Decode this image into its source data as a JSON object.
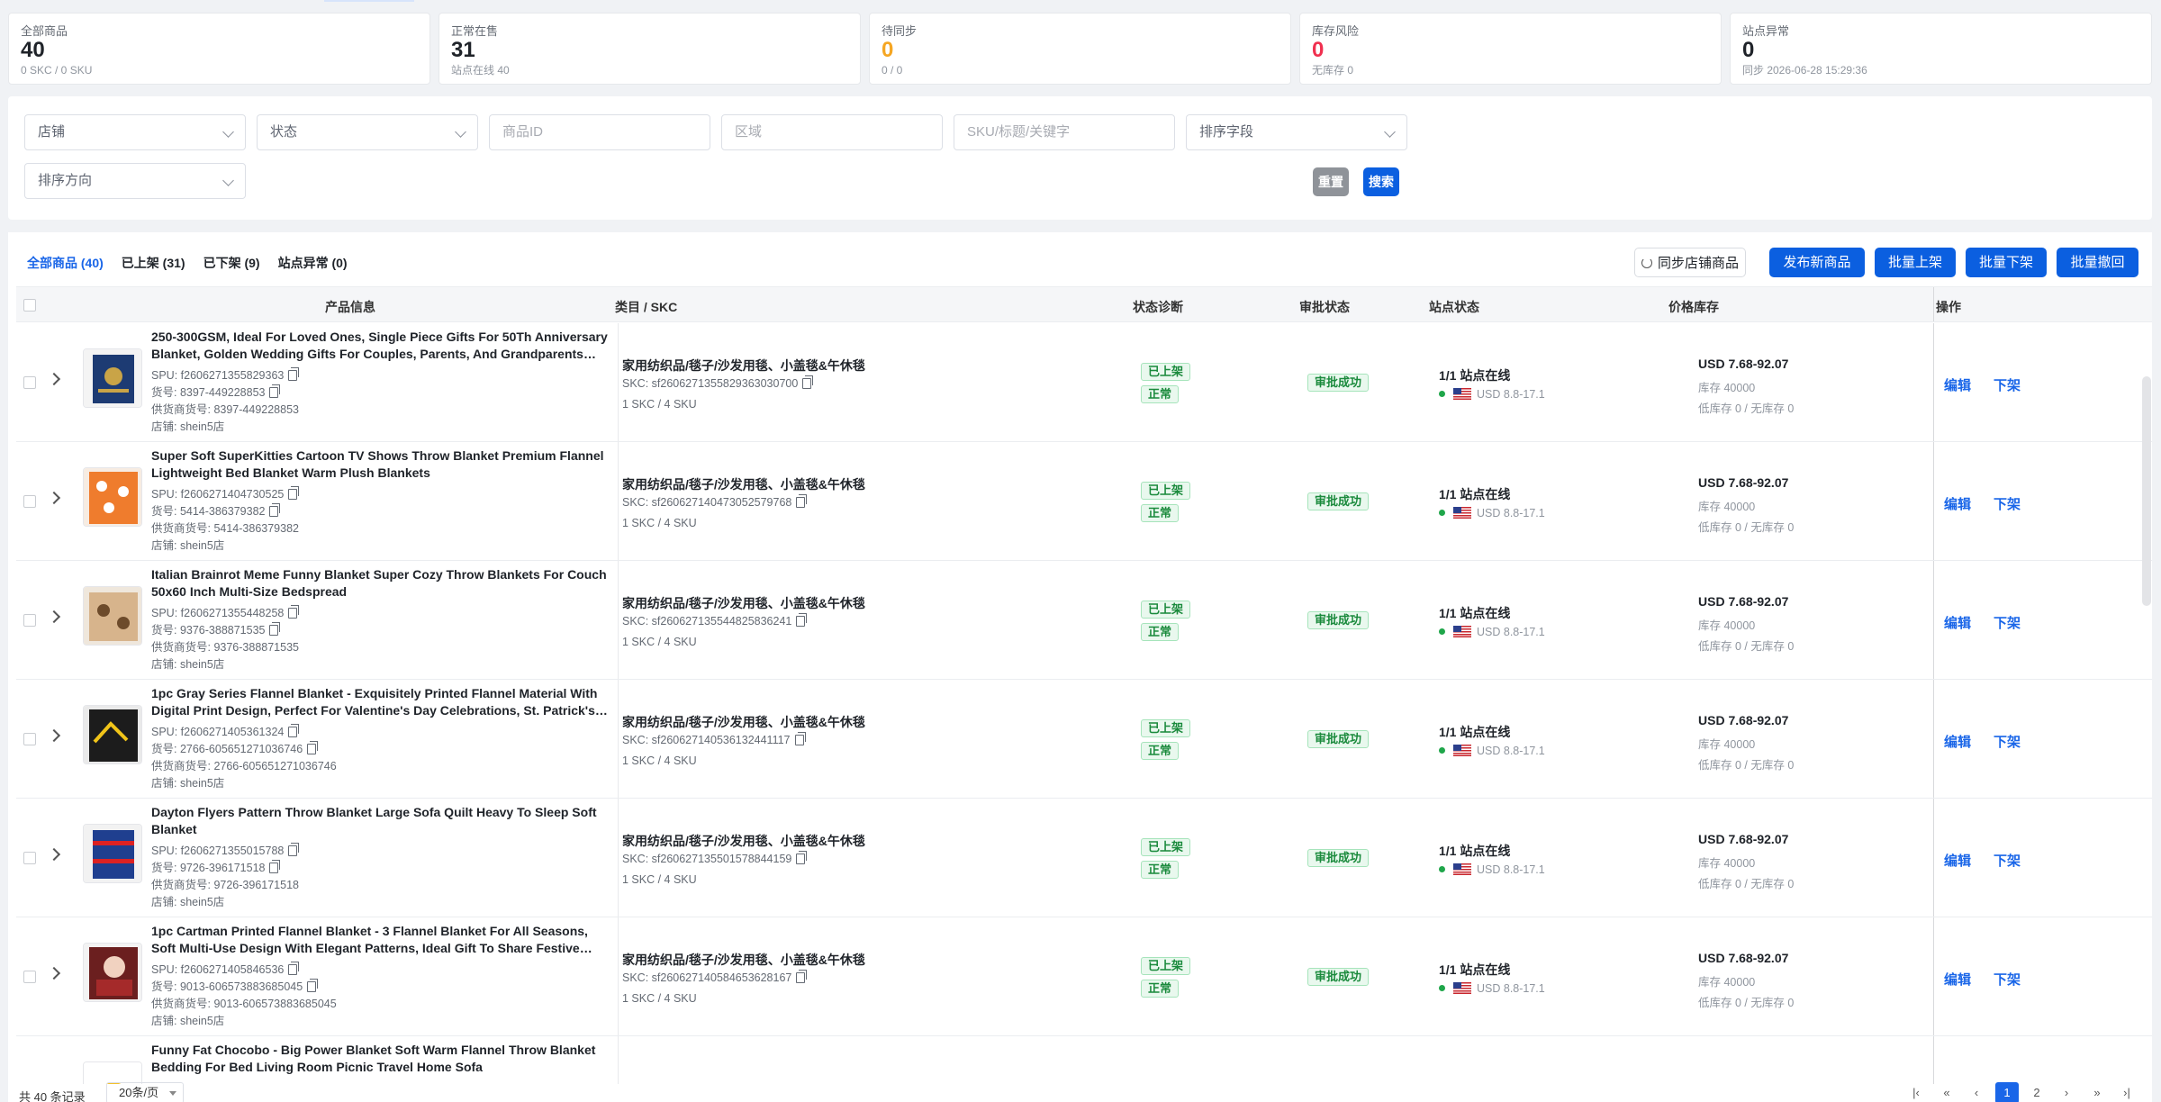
{
  "stats": [
    {
      "title": "全部商品",
      "value": "40",
      "sub": "0 SKC / 0 SKU",
      "color": "#1f2329"
    },
    {
      "title": "正常在售",
      "value": "31",
      "sub": "站点在线 40",
      "color": "#1f2329"
    },
    {
      "title": "待同步",
      "value": "0",
      "sub": "0 / 0",
      "color": "#f5a623"
    },
    {
      "title": "库存风险",
      "value": "0",
      "sub": "无库存 0",
      "color": "#f0304f"
    },
    {
      "title": "站点异常",
      "value": "0",
      "sub": "同步 2026-06-28 15:29:36",
      "color": "#1f2329"
    }
  ],
  "filters": {
    "store_placeholder": "店铺",
    "status_placeholder": "状态",
    "product_id_placeholder": "商品ID",
    "region_placeholder": "区域",
    "keyword_placeholder": "SKU/标题/关键字",
    "sort_field_placeholder": "排序字段",
    "sort_dir_placeholder": "排序方向",
    "reset_label": "重置",
    "search_label": "搜索"
  },
  "tabs": [
    {
      "label": "全部商品 (40)",
      "active": true
    },
    {
      "label": "已上架 (31)",
      "active": false
    },
    {
      "label": "已下架 (9)",
      "active": false
    },
    {
      "label": "站点异常 (0)",
      "active": false
    }
  ],
  "actions": {
    "sync_label": "同步店铺商品",
    "publish_label": "发布新商品",
    "bulk_on_label": "批量上架",
    "bulk_off_label": "批量下架",
    "bulk_withdraw_label": "批量撤回"
  },
  "columns": {
    "product": "产品信息",
    "category": "类目 / SKC",
    "status": "状态诊断",
    "approval": "审批状态",
    "site": "站点状态",
    "price": "价格库存",
    "ops": "操作"
  },
  "rows": [
    {
      "title": "250-300GSM, Ideal For Loved Ones, Single Piece Gifts For 50Th Anniversary Blanket, Golden Wedding Gifts For Couples, Parents, And Grandparents…",
      "spu": "SPU: f2606271355829363",
      "item_no": "货号: 8397-449228853",
      "supplier_no": "供货商货号: 8397-449228853",
      "store": "店铺: shein5店",
      "category": "家用纺织品/毯子/沙发用毯、小盖毯&午休毯",
      "skc": "SKC: sf2606271355829363030700",
      "skc_count": "1 SKC / 4 SKU",
      "status_tag": "已上架",
      "health_tag": "正常",
      "approval": "审批成功",
      "site": "1/1 站点在线",
      "site_price": "USD 8.8-17.1",
      "price": "USD 7.68-92.07",
      "stock": "库存 40000",
      "stock_risk": "低库存 0 / 无库存 0",
      "edit": "编辑",
      "offline": "下架",
      "thumb": "navy"
    },
    {
      "title": "Super Soft SuperKitties Cartoon TV Shows Throw Blanket Premium Flannel Lightweight Bed Blanket Warm Plush Blankets",
      "spu": "SPU: f2606271404730525",
      "item_no": "货号: 5414-386379382",
      "supplier_no": "供货商货号: 5414-386379382",
      "store": "店铺: shein5店",
      "category": "家用纺织品/毯子/沙发用毯、小盖毯&午休毯",
      "skc": "SKC: sf2606271404730525797​68",
      "skc_count": "1 SKC / 4 SKU",
      "status_tag": "已上架",
      "health_tag": "正常",
      "approval": "审批成功",
      "site": "1/1 站点在线",
      "site_price": "USD 8.8-17.1",
      "price": "USD 7.68-92.07",
      "stock": "库存 40000",
      "stock_risk": "低库存 0 / 无库存 0",
      "edit": "编辑",
      "offline": "下架",
      "thumb": "orange"
    },
    {
      "title": "Italian Brainrot Meme Funny Blanket Super Cozy Throw Blankets For Couch 50x60 Inch Multi-Size Bedspread",
      "spu": "SPU: f2606271355448258",
      "item_no": "货号: 9376-388871535",
      "supplier_no": "供货商货号: 9376-388871535",
      "store": "店铺: shein5店",
      "category": "家用纺织品/毯子/沙发用毯、小盖毯&午休毯",
      "skc": "SKC: sf2606271355448258​36241",
      "skc_count": "1 SKC / 4 SKU",
      "status_tag": "已上架",
      "health_tag": "正常",
      "approval": "审批成功",
      "site": "1/1 站点在线",
      "site_price": "USD 8.8-17.1",
      "price": "USD 7.68-92.07",
      "stock": "库存 40000",
      "stock_risk": "低库存 0 / 无库存 0",
      "edit": "编辑",
      "offline": "下架",
      "thumb": "beige"
    },
    {
      "title": "1pc Gray Series Flannel Blanket - Exquisitely Printed Flannel Material With Digital Print Design, Perfect For Valentine's Day Celebrations, St. Patrick's Day…",
      "spu": "SPU: f2606271405361324",
      "item_no": "货号: 2766-605651271036746",
      "supplier_no": "供货商货号: 2766-605651271036746",
      "store": "店铺: shein5店",
      "category": "家用纺织品/毯子/沙发用毯、小盖毯&午休毯",
      "skc": "SKC: sf2606271405361324​41117",
      "skc_count": "1 SKC / 4 SKU",
      "status_tag": "已上架",
      "health_tag": "正常",
      "approval": "审批成功",
      "site": "1/1 站点在线",
      "site_price": "USD 8.8-17.1",
      "price": "USD 7.68-92.07",
      "stock": "库存 40000",
      "stock_risk": "低库存 0 / 无库存 0",
      "edit": "编辑",
      "offline": "下架",
      "thumb": "black"
    },
    {
      "title": "Dayton Flyers Pattern Throw Blanket Large Sofa Quilt Heavy To Sleep Soft Blanket",
      "spu": "SPU: f2606271355015788",
      "item_no": "货号: 9726-396171518",
      "supplier_no": "供货商货号: 9726-396171518",
      "store": "店铺: shein5店",
      "category": "家用纺织品/毯子/沙发用毯、小盖毯&午休毯",
      "skc": "SKC: sf2606271355015788​44159",
      "skc_count": "1 SKC / 4 SKU",
      "status_tag": "已上架",
      "health_tag": "正常",
      "approval": "审批成功",
      "site": "1/1 站点在线",
      "site_price": "USD 8.8-17.1",
      "price": "USD 7.68-92.07",
      "stock": "库存 40000",
      "stock_risk": "低库存 0 / 无库存 0",
      "edit": "编辑",
      "offline": "下架",
      "thumb": "blue"
    },
    {
      "title": "1pc Cartman Printed Flannel Blanket - 3 Flannel Blanket For All Seasons, Soft Multi-Use Design With Elegant Patterns, Ideal Gift To Share Festive Love For…",
      "spu": "SPU: f2606271405846536",
      "item_no": "货号: 9013-606573883685045",
      "supplier_no": "供货商货号: 9013-606573883685045",
      "store": "店铺: shein5店",
      "category": "家用纺织品/毯子/沙发用毯、小盖毯&午休毯",
      "skc": "SKC: sf2606271405846536​28167",
      "skc_count": "1 SKC / 4 SKU",
      "status_tag": "已上架",
      "health_tag": "正常",
      "approval": "审批成功",
      "site": "1/1 站点在线",
      "site_price": "USD 8.8-17.1",
      "price": "USD 7.68-92.07",
      "stock": "库存 40000",
      "stock_risk": "低库存 0 / 无库存 0",
      "edit": "编辑",
      "offline": "下架",
      "thumb": "anime"
    },
    {
      "title": "Funny Fat Chocobo - Big Power Blanket Soft Warm Flannel Throw Blanket Bedding For Bed Living Room Picnic Travel Home Sofa",
      "spu": "",
      "item_no": "",
      "supplier_no": "",
      "store": "",
      "category": "",
      "skc": "",
      "skc_count": "",
      "status_tag": "",
      "health_tag": "",
      "approval": "",
      "site": "",
      "site_price": "",
      "price": "",
      "stock": "",
      "stock_risk": "",
      "edit": "",
      "offline": "",
      "thumb": "yellow"
    }
  ],
  "footer": {
    "total": "共 40 条记录",
    "page_size": "20条/页",
    "pages": [
      "1",
      "2"
    ]
  },
  "colors": {
    "primary": "#0b5fe0",
    "link": "#1a66e8",
    "reset": "#8f9399",
    "success_bg": "#e9f8ee",
    "success_text": "#1a8a3c"
  }
}
